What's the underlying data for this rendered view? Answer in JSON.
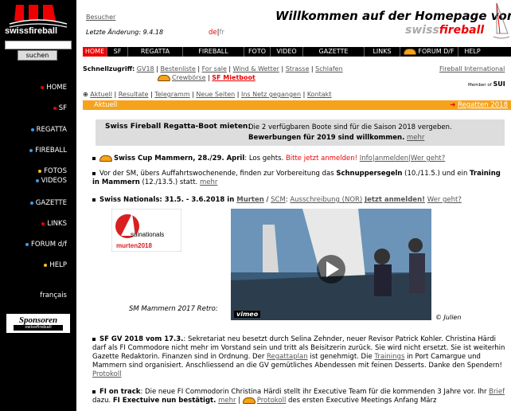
{
  "sidebar": {
    "logo_text": "swissfireball",
    "search_placeholder": "",
    "search_button": "suchen",
    "items": [
      {
        "label": "HOME",
        "dot": "#e00"
      },
      {
        "label": "SF",
        "dot": "#e00"
      },
      {
        "label": "REGATTA",
        "dot": "#3b9be8"
      },
      {
        "label": "FIREBALL",
        "dot": "#3b9be8"
      },
      {
        "label": "FOTOS",
        "dot": "#f7c21b"
      },
      {
        "label": "VIDEOS",
        "dot": "#3b9be8"
      },
      {
        "label": "GAZETTE",
        "dot": "#3b9be8"
      },
      {
        "label": "LINKS",
        "dot": "#e00"
      },
      {
        "label": "FORUM d/f",
        "dot": "#3b9be8"
      },
      {
        "label": "HELP",
        "dot": "#f7c21b"
      }
    ],
    "language": "français",
    "sponsors_title": "Sponsoren",
    "sponsors_sub": "swissfireball"
  },
  "header": {
    "visitors": "Besucher",
    "updated": "Letzte Änderung: 9.4.18",
    "lang_de": "de",
    "lang_sep": "|",
    "lang_fr": "fr",
    "welcome": "Willkommen auf der Homepage von",
    "brand_swiss": "swiss",
    "brand_fireball": "fireball"
  },
  "topnav": [
    "HOME",
    "SF",
    "REGATTA",
    "FIREBALL",
    "FOTO",
    "VIDEO",
    "GAZETTE",
    "LINKS",
    "FORUM d/f",
    "HELP"
  ],
  "quick": {
    "label": "Schnellzugriff:",
    "links": [
      "GV18",
      "Bestenliste",
      "For sale",
      "Wind & Wetter",
      "Strasse",
      "Schlafen"
    ],
    "crew": "Crewbörse",
    "mietboot": "SF Mietboot",
    "fi_int": "Fireball International",
    "member": "Member of",
    "member_org": "SUI"
  },
  "subnav": [
    "Aktuell",
    "Resultate",
    "Telegramm",
    "Neue Seiten",
    "Ins Netz gegangen",
    "Kontakt"
  ],
  "aktuell_bar": {
    "label": "Aktuell",
    "link": "Regatten 2018"
  },
  "boot_box": {
    "title": "Swiss Fireball Regatta-Boot mieten:",
    "text1": "Die 2 verfügbaren Boote sind für die Saison 2018 vergeben.",
    "text2": "Bewerbungen für 2019 sind willkommen.",
    "more": "mehr"
  },
  "news": {
    "cup_title": "Swiss Cup Mammern, 28./29. April",
    "cup_text": ": Los gehts.",
    "cup_red": "Bitte jetzt anmelden!",
    "cup_links": "Info|anmelden|Wer geht?",
    "sm_text1": "Vor der SM, übers Auffahrtswochenende, finden zur Vorbereitung das ",
    "sm_b1": "Schnuppersegeln",
    "sm_text2": " (10./11.5.) und ein ",
    "sm_b2": "Training in Mammern",
    "sm_text3": " (12./13.5.) statt.",
    "sm_more": "mehr",
    "nat_title": "Swiss Nationals: 31.5. - 3.6.2018 in ",
    "nat_murten": "Murten",
    "nat_scm": "SCM",
    "nat_reg": "Ausschreibung (NOR)",
    "nat_join": "Jetzt anmelden!",
    "nat_who": "Wer geht?",
    "nat_logo_line": "suinationals",
    "nat_logo_city": "murten2018",
    "sm_caption": "SM Mammern 2017 Retro:",
    "vimeo": "vimeo",
    "credit": "© Julien",
    "gv_title": "SF GV 2018 vom 17.3.",
    "gv_text": ": Sekretariat neu besetzt durch Selina Zehnder, neuer Revisor Patrick Kohler. Christina Härdi darf als FI Commodore nicht mehr im Vorstand sein und tritt als Beisitzerin zurück. Sie wird nicht ersetzt. Sie ist weiterhin Gazette Redaktorin. Finanzen sind in Ordnung. Der ",
    "gv_link1": "Regattaplan",
    "gv_text2": " ist genehmigt. Die ",
    "gv_link2": "Trainings",
    "gv_text3": " in Port Camargue und Mammern sind organisiert. Anschliessend an die GV gemütliches Abendessen mit feinen Desserts. Danke den Spendern!",
    "gv_protokoll": "Protokoll",
    "fi_title": "FI on track",
    "fi_text": ": Die neue FI Commodorin Christina Härdi stellt ihr Executive Team für die kommenden 3 Jahre vor. Ihr ",
    "fi_brief": "Brief",
    "fi_text2": " dazu. ",
    "fi_b": "FI Exectuive nun bestätigt.",
    "fi_more": "mehr",
    "fi_protokoll": "Protokoll",
    "fi_text3": " des ersten Executive Meetings Anfang März"
  }
}
